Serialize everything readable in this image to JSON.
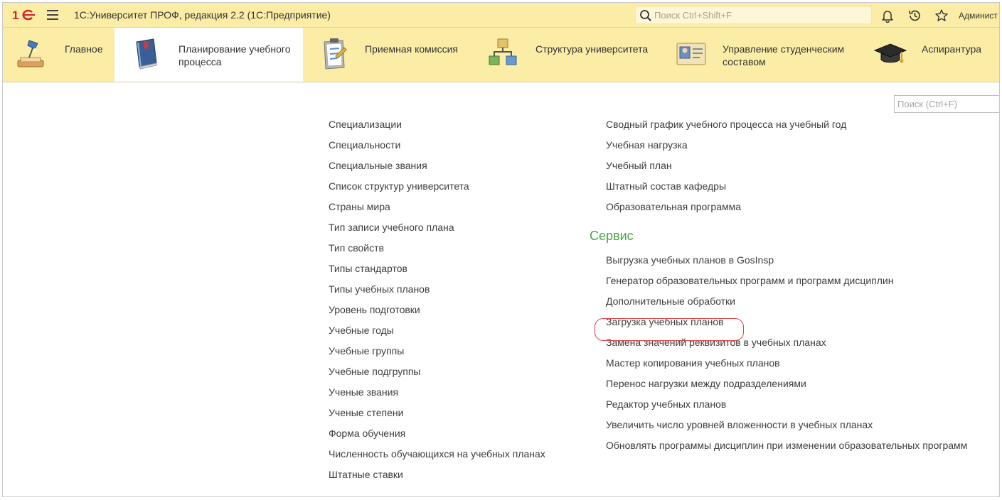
{
  "titlebar": {
    "app_title": "1С:Университет ПРОФ, редакция 2.2  (1С:Предприятие)",
    "search_placeholder": "Поиск Ctrl+Shift+F",
    "user_name": "Админист",
    "icons": [
      "notifications-bell-icon",
      "history-icon",
      "favorites-star-icon"
    ]
  },
  "sections": [
    {
      "id": "glavnoe",
      "label_lines": [
        "Главное"
      ],
      "icon": "desk-lamp-icon",
      "active": false
    },
    {
      "id": "planning",
      "label_lines": [
        "Планирование учебного",
        "процесса"
      ],
      "icon": "book-icon",
      "active": true
    },
    {
      "id": "admission",
      "label_lines": [
        "Приемная комиссия"
      ],
      "icon": "clipboard-icon",
      "active": false
    },
    {
      "id": "structure",
      "label_lines": [
        "Структура университета"
      ],
      "icon": "org-structure-icon",
      "active": false
    },
    {
      "id": "students",
      "label_lines": [
        "Управление студенческим",
        "составом"
      ],
      "icon": "id-card-icon",
      "active": false
    },
    {
      "id": "postgrad",
      "label_lines": [
        "Аспирантура"
      ],
      "icon": "graduation-cap-icon",
      "active": false
    }
  ],
  "content": {
    "search_placeholder": "Поиск (Ctrl+F)",
    "left_links": [
      "Специализации",
      "Специальности",
      "Специальные звания",
      "Список структур университета",
      "Страны мира",
      "Тип записи учебного плана",
      "Тип свойств",
      "Типы стандартов",
      "Типы учебных планов",
      "Уровень подготовки",
      "Учебные годы",
      "Учебные группы",
      "Учебные подгруппы",
      "Ученые звания",
      "Ученые степени",
      "Форма обучения",
      "Численность обучающихся на учебных планах",
      "Штатные ставки"
    ],
    "right_links": [
      "Сводный график учебного процесса на учебный год",
      "Учебная нагрузка",
      "Учебный план",
      "Штатный состав кафедры",
      "Образовательная программа"
    ],
    "service_title": "Сервис",
    "service_links": [
      "Выгрузка учебных планов в GosInsp",
      "Генератор образовательных программ и программ дисциплин",
      "Дополнительные обработки",
      "Загрузка учебных планов",
      "Замена значений реквизитов в учебных планах",
      "Мастер копирования учебных планов",
      "Перенос нагрузки между подразделениями",
      "Редактор учебных планов",
      "Увеличить число уровней вложенности в учебных планах",
      "Обновлять программы дисциплин при изменении образовательных программ"
    ],
    "highlighted_link": "Загрузка учебных планов"
  },
  "colors": {
    "header_bg": "#fbeda6",
    "active_section_bg": "#ffffff",
    "group_title": "#4aa542",
    "highlight_outline": "#e0454a",
    "logo_red": "#d0262d"
  }
}
